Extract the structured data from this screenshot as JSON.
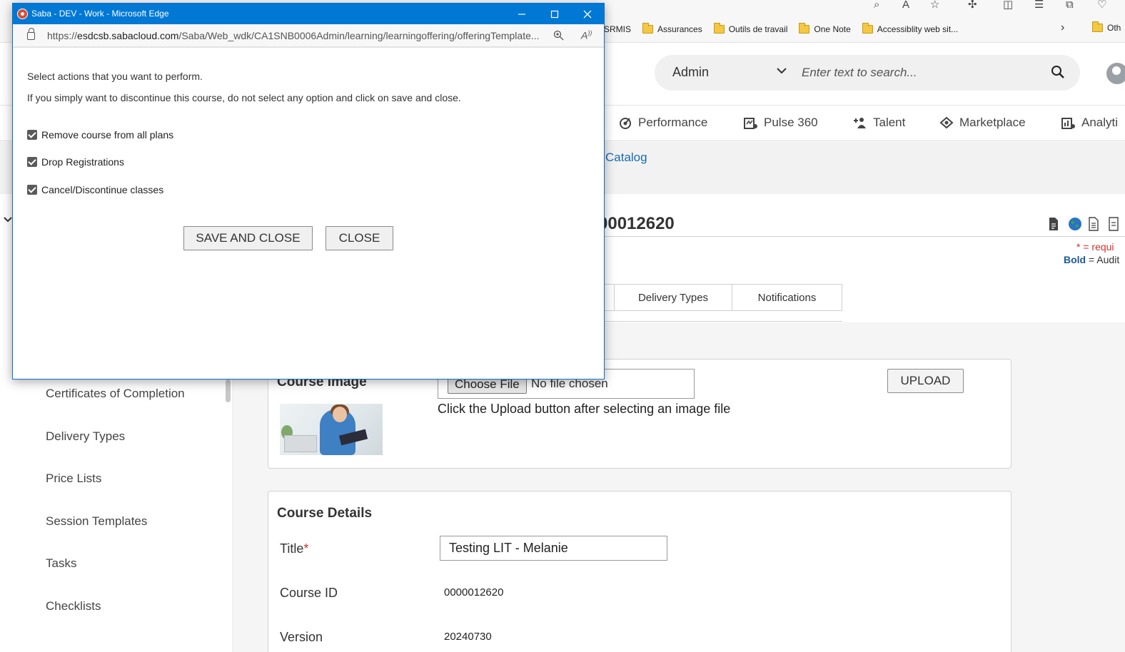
{
  "browser": {
    "favorites": [
      "SRMIS",
      "Assurances",
      "Outils de travail",
      "One Note",
      "Accessiblity web sit..."
    ],
    "favorites_other": "Oth"
  },
  "header": {
    "role": "Admin",
    "search_placeholder": "Enter text to search..."
  },
  "nav": {
    "items": [
      "Performance",
      "Pulse 360",
      "Talent",
      "Marketplace",
      "Analyti"
    ]
  },
  "breadcrumb": {
    "link": "Catalog"
  },
  "page": {
    "title_fragment": "00012620",
    "required_note": "* = requi",
    "bold_note_label": "Bold",
    "bold_note_text": " = Audit"
  },
  "tabs": [
    "Delivery Types",
    "Notifications"
  ],
  "sidebar": {
    "items": [
      "Certificates of Completion",
      "Delivery Types",
      "Price Lists",
      "Session Templates",
      "Tasks",
      "Checklists"
    ]
  },
  "course_image": {
    "heading": "Course Image",
    "choose_label": "Choose File",
    "no_file": "No file chosen",
    "hint": "Click the Upload button after selecting an image file",
    "upload_label": "UPLOAD"
  },
  "course_details": {
    "heading": "Course Details",
    "title_label": "Title",
    "title_value": "Testing LIT - Melanie",
    "id_label": "Course ID",
    "id_value": "0000012620",
    "version_label": "Version",
    "version_value": "20240730"
  },
  "popup": {
    "window_title": "Saba - DEV - Work - Microsoft Edge",
    "url_scheme": "https://",
    "url_host": "esdcsb.sabacloud.com",
    "url_path": "/Saba/Web_wdk/CA1SNB0006Admin/learning/learningoffering/offeringTemplate...",
    "instruction_1": "Select actions that you want to perform.",
    "instruction_2": "If you simply want to discontinue this course, do not select any option and click on save and close.",
    "options": [
      {
        "label": "Remove course from all plans",
        "checked": true
      },
      {
        "label": "Drop Registrations",
        "checked": true
      },
      {
        "label": "Cancel/Discontinue classes",
        "checked": true
      }
    ],
    "save_label": "SAVE AND CLOSE",
    "close_label": "CLOSE"
  },
  "colors": {
    "popup_titlebar": "#0078d4",
    "link": "#1a6bb0",
    "required": "#d0312d"
  }
}
